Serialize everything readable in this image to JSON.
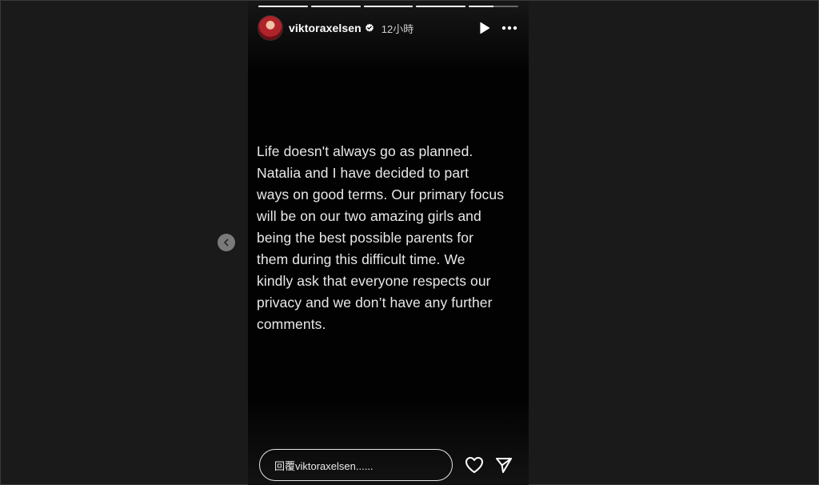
{
  "story": {
    "progress": [
      {
        "fill": 1.0
      },
      {
        "fill": 1.0
      },
      {
        "fill": 1.0
      },
      {
        "fill": 1.0
      },
      {
        "fill": 0.5
      }
    ],
    "header": {
      "username": "viktoraxelsen",
      "time": "12小時",
      "verified_icon": "verified-badge-icon",
      "play_icon": "play-icon",
      "more_icon": "more-options-icon"
    },
    "text_lines": [
      "Life doesn't always go as planned.",
      "Natalia and I have decided to part",
      "ways on good terms. Our primary focus",
      "will be on our two amazing girls and",
      "being the best possible parents for",
      "them during this difficult time. We",
      "kindly ask that everyone respects our",
      "privacy and we don’t have any further",
      "comments."
    ],
    "reply": {
      "placeholder": "回覆viktoraxelsen......",
      "like_icon": "heart-icon",
      "share_icon": "send-icon"
    }
  },
  "navigation": {
    "prev_icon": "chevron-left-icon"
  },
  "colors": {
    "page_background": "#1a1a1a",
    "story_background": "#020202",
    "text": "#e9e9e9",
    "nav_button": "#7a7a7a"
  }
}
